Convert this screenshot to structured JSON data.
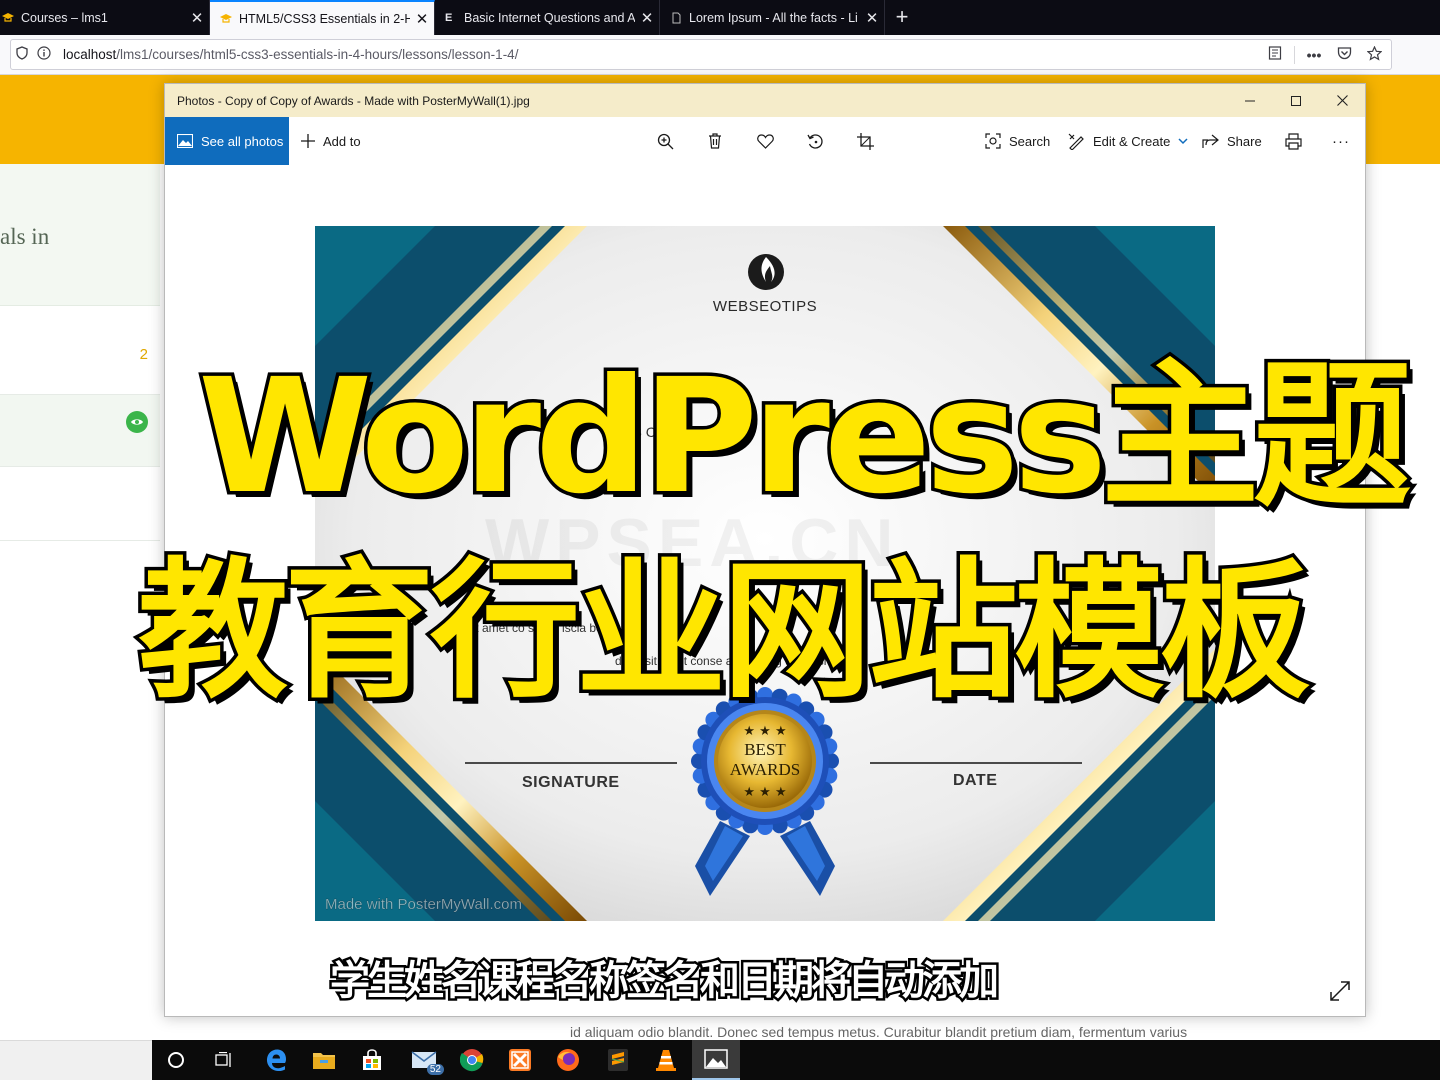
{
  "browser": {
    "tabs": [
      {
        "title": "Courses – lms1",
        "active": false
      },
      {
        "title": "HTML5/CSS3 Essentials in 2-Ho",
        "active": true
      },
      {
        "title": "Basic Internet Questions and A",
        "active": false
      },
      {
        "title": "Lorem Ipsum - All the facts - Li",
        "active": false
      }
    ],
    "close_glyph": "✕",
    "new_tab_glyph": "+",
    "url_host": "localhost",
    "url_path": "/lms1/courses/html5-css3-essentials-in-4-hours/lessons/lesson-1-4/"
  },
  "page_behind": {
    "title_fragment": "als in",
    "lesson_count": "2",
    "bottom_text": "id aliquam odio blandit. Donec sed tempus metus. Curabitur blandit pretium diam, fermentum varius",
    "accent_color": "#f6b400"
  },
  "photos": {
    "window_title": "Photos - Copy of Copy of Awards - Made with PosterMyWall(1).jpg",
    "see_all": "See all photos",
    "add_to": "Add to",
    "search": "Search",
    "edit_create": "Edit & Create",
    "share": "Share",
    "more": "···",
    "accent_color": "#0f6cbd",
    "certificate": {
      "brand": "WEBSEOTIPS",
      "line_fragment": "THIS C          FICA",
      "watermark": "WPSEA.CN",
      "lorem_line1": "psum          it amet co          sicing          iscia          bo",
      "lorem_line2": "dolor sit amet conse          adipisicing          do eiusmo.",
      "signature_label": "SIGNATURE",
      "date_label": "DATE",
      "badge_line1": "BEST",
      "badge_line2": "AWARDS",
      "made_with": "Made with PosterMyWall.com"
    }
  },
  "overlay": {
    "headline1": "WordPress主题",
    "headline2": "教育行业网站模板",
    "subtitle": "学生姓名课程名称签名和日期将自动添加",
    "headline_color": "#ffe600"
  },
  "taskbar": {
    "mail_badge": "52",
    "icons": [
      "search-icon",
      "task-view-icon",
      "edge-icon",
      "file-explorer-icon",
      "store-icon",
      "mail-icon",
      "chrome-icon",
      "xampp-icon",
      "firefox-icon",
      "sublime-icon",
      "vlc-icon",
      "photos-icon"
    ]
  }
}
